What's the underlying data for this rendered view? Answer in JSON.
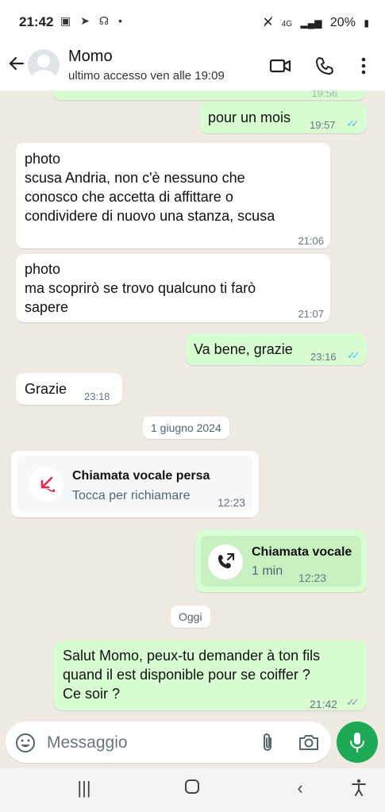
{
  "status_bar": {
    "time": "21:42",
    "left_icons": "▣ ➤ ☊ •",
    "network": "4G",
    "battery": "20%"
  },
  "header": {
    "contact_name": "Momo",
    "last_seen": "ultimo accesso ven alle 19:09"
  },
  "messages": [
    {
      "text": "19:56",
      "partial": true
    },
    {
      "text": "pour un mois",
      "time": "19:57"
    },
    {
      "text": "photo\nscusa Andria, non c'è nessuno che conosco che accetta di affittare o condividere di nuovo una stanza, scusa",
      "time": "21:06"
    },
    {
      "text": "photo\nma scoprirò se trovo qualcuno ti farò sapere",
      "time": "21:07"
    },
    {
      "text": "Va bene, grazie",
      "time": "23:16"
    },
    {
      "text": "Grazie",
      "time": "23:18"
    }
  ],
  "msg_lines": {
    "m2_l1": "photo",
    "m2_l2": "scusa Andria, non c'è nessuno che",
    "m2_l3": "conosco che accetta di affittare o",
    "m2_l4": "condividere di nuovo una stanza, scusa",
    "m3_l1": "photo",
    "m3_l2": "ma scoprirò se trovo qualcuno ti farò",
    "m3_l3": "sapere"
  },
  "date_chips": {
    "first": "1 giugno 2024",
    "today": "Oggi"
  },
  "missed_call": {
    "title": "Chiamata vocale persa",
    "subtitle": "Tocca per richiamare",
    "time": "12:23"
  },
  "voice_call": {
    "title": "Chiamata vocale",
    "duration": "1 min",
    "time": "12:23"
  },
  "last_message": {
    "line1": "Salut Momo, peux-tu demander à ton fils",
    "line2": "quand il est disponible pour se coiffer ?",
    "line3": "Ce soir ?",
    "time": "21:42"
  },
  "input": {
    "placeholder": "Messaggio"
  },
  "colors": {
    "outgoing": "#d9fdd3",
    "incoming": "#ffffff",
    "read_ticks": "#53bdeb",
    "mic": "#1da955",
    "missed": "#e5284a"
  },
  "icons": [
    "back-arrow-icon",
    "video-call-icon",
    "phone-icon",
    "more-options-icon",
    "emoji-icon",
    "attach-icon",
    "camera-icon",
    "mic-icon",
    "missed-call-icon",
    "outgoing-call-icon"
  ]
}
